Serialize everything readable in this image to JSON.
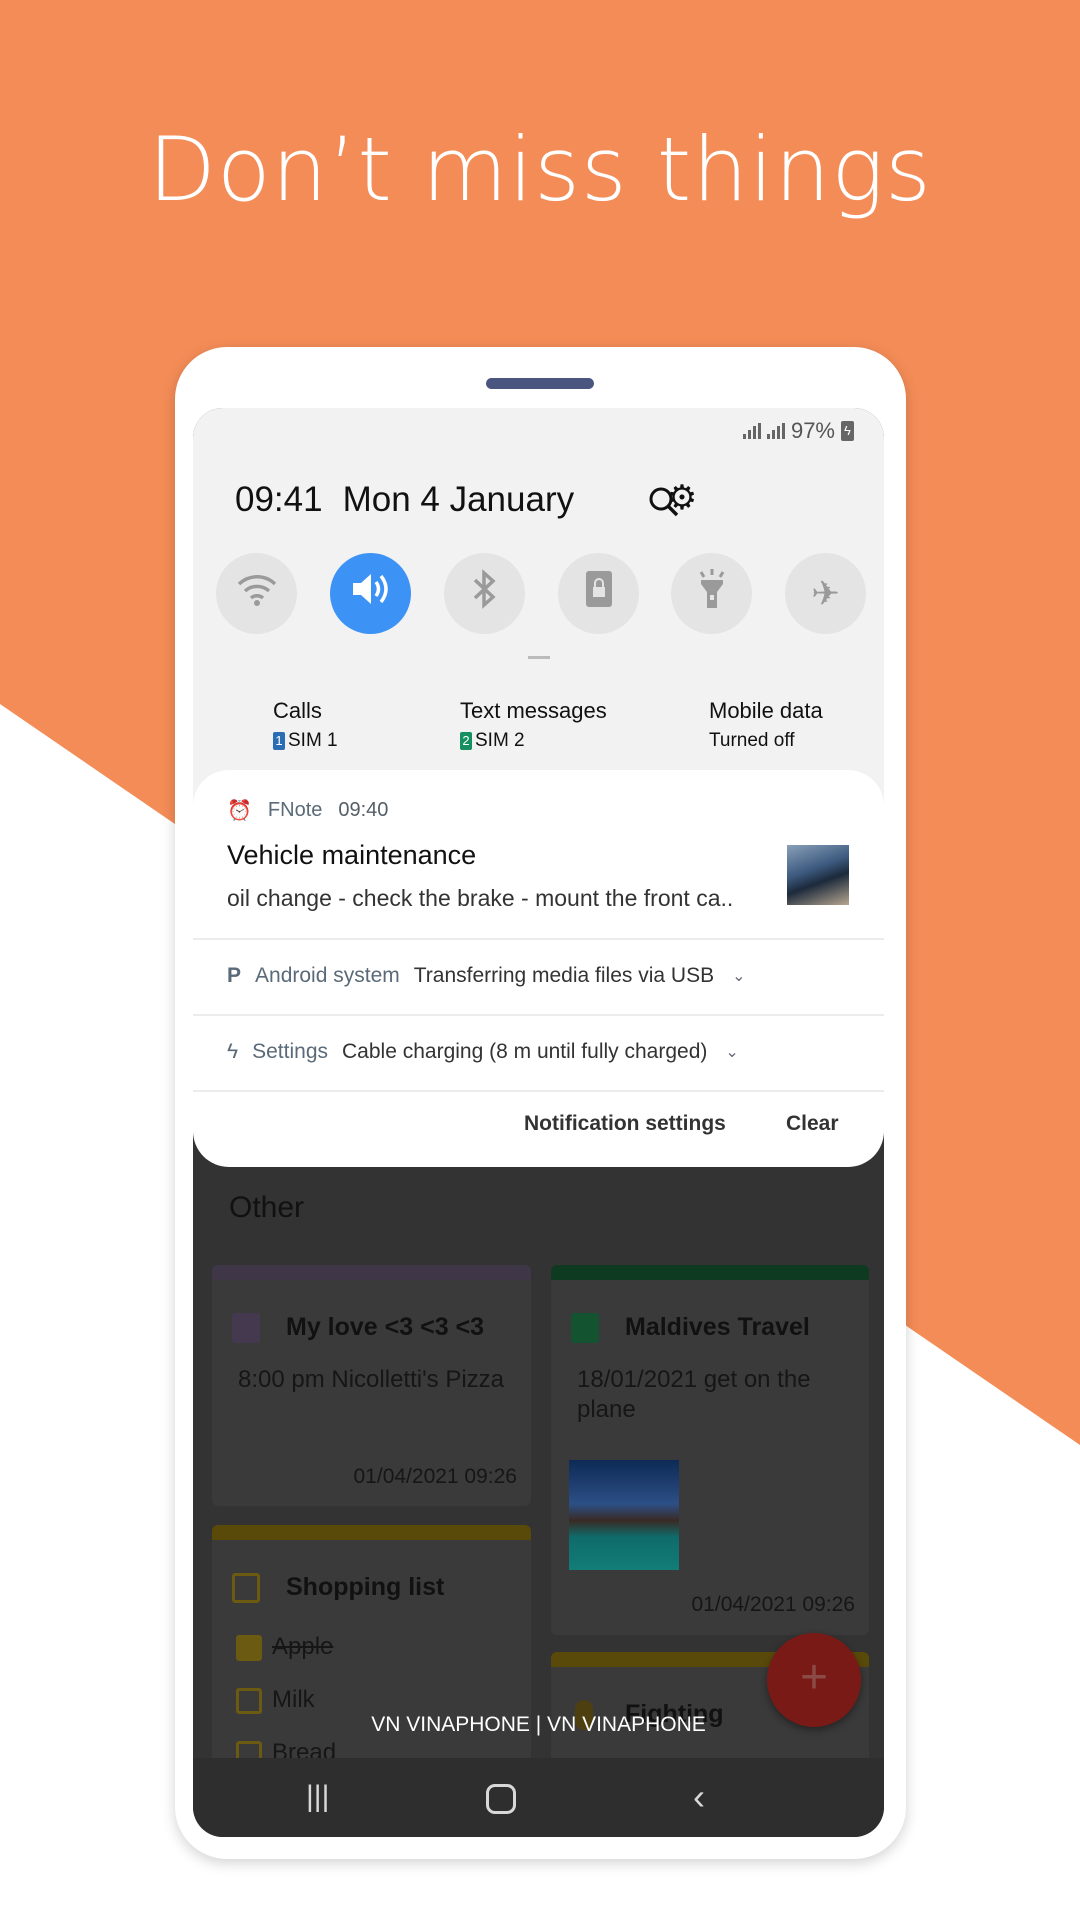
{
  "colors": {
    "background": "#F48C57",
    "accent": "#3D93F5"
  },
  "headline": "Don’t miss things",
  "status": {
    "battery": "97%"
  },
  "quick_panel": {
    "time": "09:41",
    "date": "Mon 4 January",
    "toggles": [
      {
        "icon": "wifi-icon",
        "on": false
      },
      {
        "icon": "sound-icon",
        "on": true
      },
      {
        "icon": "bluetooth-icon",
        "on": false
      },
      {
        "icon": "screen-lock-icon",
        "on": false
      },
      {
        "icon": "flashlight-icon",
        "on": false
      },
      {
        "icon": "airplane-icon",
        "on": false
      }
    ],
    "sim": [
      {
        "label": "Calls",
        "badge": "1",
        "value": "SIM 1"
      },
      {
        "label": "Text messages",
        "badge": "2",
        "value": "SIM 2"
      },
      {
        "label": "Mobile data",
        "value": "Turned off"
      }
    ]
  },
  "notifications": {
    "fnote": {
      "app": "FNote",
      "time": "09:40",
      "title": "Vehicle maintenance",
      "body": "oil change - check the brake - mount the front ca.."
    },
    "android": {
      "app": "Android system",
      "text": "Transferring media files via USB"
    },
    "settings": {
      "app": "Settings",
      "text": "Cable charging (8 m until fully charged)"
    },
    "actions": {
      "settings": "Notification settings",
      "clear": "Clear"
    }
  },
  "notes": {
    "section": "Other",
    "cards": [
      {
        "title": "My love <3 <3 <3",
        "body": "8:00 pm Nicolletti's Pizza",
        "date": "01/04/2021 09:26"
      },
      {
        "title": "Maldives Travel",
        "body": "18/01/2021 get on the plane",
        "date": "01/04/2021 09:26"
      },
      {
        "title": "Shopping list",
        "items": [
          {
            "text": "Apple",
            "checked": true
          },
          {
            "text": "Milk",
            "checked": false
          },
          {
            "text": "Bread",
            "checked": false
          }
        ]
      },
      {
        "title": "Fighting"
      }
    ],
    "fab": "+"
  },
  "carrier": "VN VINAPHONE | VN VINAPHONE"
}
